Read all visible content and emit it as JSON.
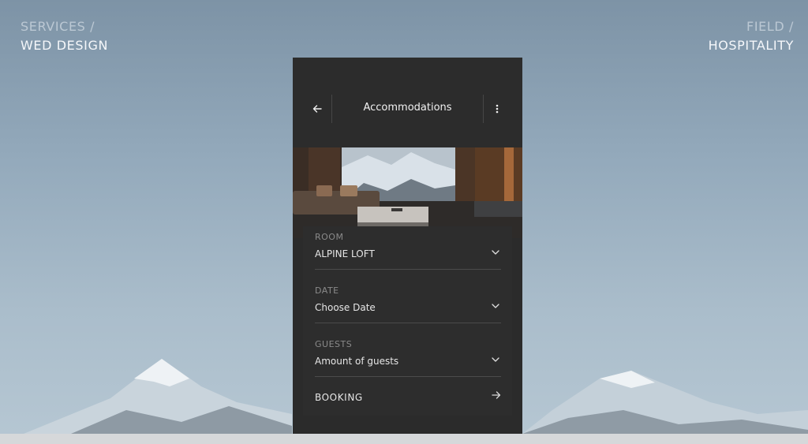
{
  "corner_left": {
    "line1": "SERVICES /",
    "line2": "WED DESIGN"
  },
  "corner_right": {
    "line1": "FIELD /",
    "line2": "HOSPITALITY"
  },
  "app": {
    "title": "Accommodations",
    "back_icon": "arrow-left-icon",
    "menu_icon": "more-vertical-icon"
  },
  "form": {
    "room": {
      "label": "ROOM",
      "value": "ALPINE LOFT"
    },
    "date": {
      "label": "DATE",
      "value": "Choose Date"
    },
    "guests": {
      "label": "GUESTS",
      "value": "Amount of guests"
    },
    "booking_label": "BOOKING"
  },
  "colors": {
    "panel": "#2b2b2b",
    "text": "#e6e6e6",
    "label": "#8a8a8a",
    "sky": "#93a9bb"
  }
}
